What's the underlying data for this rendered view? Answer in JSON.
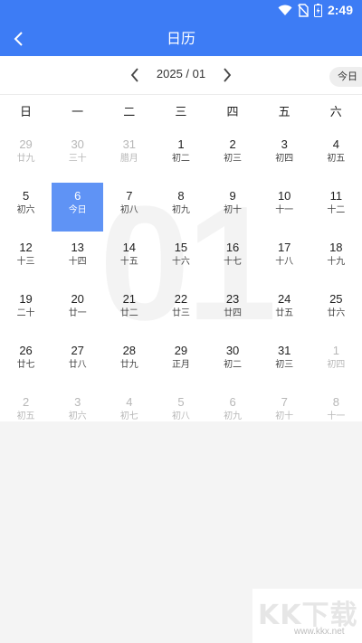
{
  "status_bar": {
    "time": "2:49"
  },
  "app_bar": {
    "title": "日历"
  },
  "calendar": {
    "month_label": "2025 / 01",
    "today_label": "今日",
    "watermark_digits": "01",
    "weekdays": [
      "日",
      "一",
      "二",
      "三",
      "四",
      "五",
      "六"
    ],
    "weeks": [
      [
        {
          "day": "29",
          "lunar": "廿九",
          "current": false
        },
        {
          "day": "30",
          "lunar": "三十",
          "current": false
        },
        {
          "day": "31",
          "lunar": "腊月",
          "current": false
        },
        {
          "day": "1",
          "lunar": "初二",
          "current": true
        },
        {
          "day": "2",
          "lunar": "初三",
          "current": true
        },
        {
          "day": "3",
          "lunar": "初四",
          "current": true
        },
        {
          "day": "4",
          "lunar": "初五",
          "current": true
        }
      ],
      [
        {
          "day": "5",
          "lunar": "初六",
          "current": true
        },
        {
          "day": "6",
          "lunar": "今日",
          "current": true,
          "selected": true
        },
        {
          "day": "7",
          "lunar": "初八",
          "current": true
        },
        {
          "day": "8",
          "lunar": "初九",
          "current": true
        },
        {
          "day": "9",
          "lunar": "初十",
          "current": true
        },
        {
          "day": "10",
          "lunar": "十一",
          "current": true
        },
        {
          "day": "11",
          "lunar": "十二",
          "current": true
        }
      ],
      [
        {
          "day": "12",
          "lunar": "十三",
          "current": true
        },
        {
          "day": "13",
          "lunar": "十四",
          "current": true
        },
        {
          "day": "14",
          "lunar": "十五",
          "current": true
        },
        {
          "day": "15",
          "lunar": "十六",
          "current": true
        },
        {
          "day": "16",
          "lunar": "十七",
          "current": true
        },
        {
          "day": "17",
          "lunar": "十八",
          "current": true
        },
        {
          "day": "18",
          "lunar": "十九",
          "current": true
        }
      ],
      [
        {
          "day": "19",
          "lunar": "二十",
          "current": true
        },
        {
          "day": "20",
          "lunar": "廿一",
          "current": true
        },
        {
          "day": "21",
          "lunar": "廿二",
          "current": true
        },
        {
          "day": "22",
          "lunar": "廿三",
          "current": true
        },
        {
          "day": "23",
          "lunar": "廿四",
          "current": true
        },
        {
          "day": "24",
          "lunar": "廿五",
          "current": true
        },
        {
          "day": "25",
          "lunar": "廿六",
          "current": true
        }
      ],
      [
        {
          "day": "26",
          "lunar": "廿七",
          "current": true
        },
        {
          "day": "27",
          "lunar": "廿八",
          "current": true
        },
        {
          "day": "28",
          "lunar": "廿九",
          "current": true
        },
        {
          "day": "29",
          "lunar": "正月",
          "current": true
        },
        {
          "day": "30",
          "lunar": "初二",
          "current": true
        },
        {
          "day": "31",
          "lunar": "初三",
          "current": true
        },
        {
          "day": "1",
          "lunar": "初四",
          "current": false
        }
      ],
      [
        {
          "day": "2",
          "lunar": "初五",
          "current": false
        },
        {
          "day": "3",
          "lunar": "初六",
          "current": false
        },
        {
          "day": "4",
          "lunar": "初七",
          "current": false
        },
        {
          "day": "5",
          "lunar": "初八",
          "current": false
        },
        {
          "day": "6",
          "lunar": "初九",
          "current": false
        },
        {
          "day": "7",
          "lunar": "初十",
          "current": false
        },
        {
          "day": "8",
          "lunar": "十一",
          "current": false
        }
      ]
    ]
  },
  "watermark": {
    "logo_text": "KK下载",
    "url": "www.kkx.net"
  },
  "colors": {
    "primary": "#3d7cf5",
    "selected": "#5f93f5",
    "other_month": "#b7b7b7"
  }
}
